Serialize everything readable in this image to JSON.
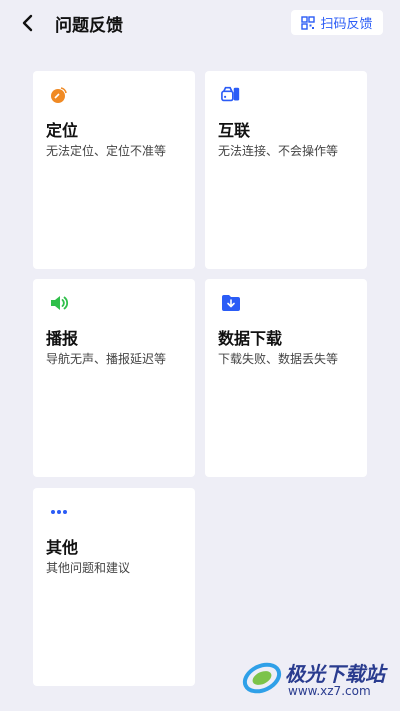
{
  "header": {
    "title": "问题反馈",
    "scan_label": "扫码反馈"
  },
  "cards": [
    {
      "title": "定位",
      "desc": "无法定位、定位不准等",
      "icon": "satellite-icon",
      "color": "#f08a24"
    },
    {
      "title": "互联",
      "desc": "无法连接、不会操作等",
      "icon": "car-phone-icon",
      "color": "#2b5cf6"
    },
    {
      "title": "播报",
      "desc": "导航无声、播报延迟等",
      "icon": "speaker-icon",
      "color": "#2fbf4a"
    },
    {
      "title": "数据下载",
      "desc": "下载失败、数据丢失等",
      "icon": "folder-download-icon",
      "color": "#2b5cf6"
    },
    {
      "title": "其他",
      "desc": "其他问题和建议",
      "icon": "more-dots-icon",
      "color": "#2b5cf6"
    }
  ],
  "watermark": {
    "text": "极光下载站",
    "url": "www.xz7.com"
  }
}
